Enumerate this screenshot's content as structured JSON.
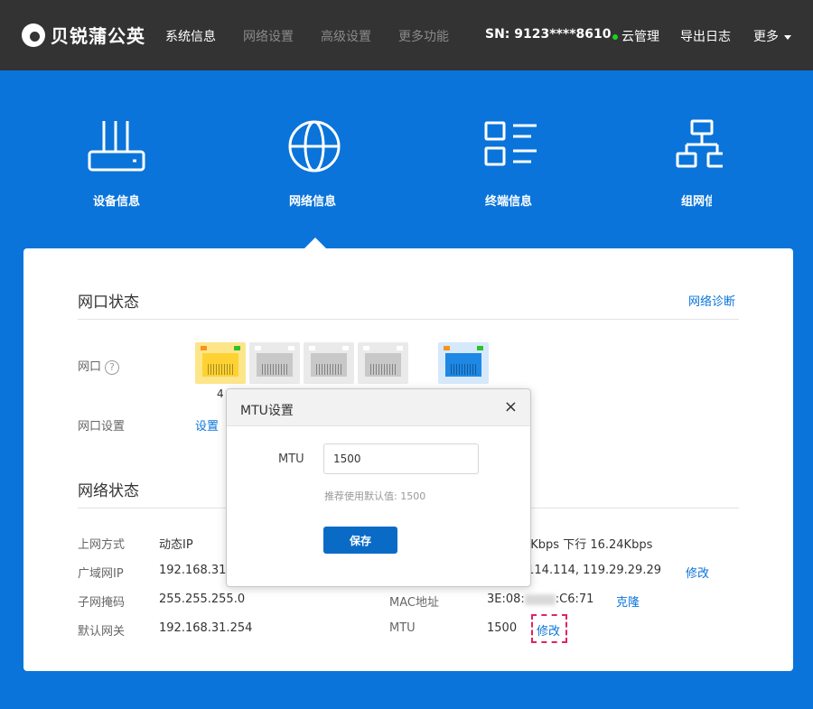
{
  "brand": {
    "name": "贝锐蒲公英"
  },
  "nav": {
    "items": [
      "系统信息",
      "网络设置",
      "高级设置",
      "更多功能"
    ]
  },
  "header": {
    "sn": "SN: 9123****8610",
    "cloud": "云管理",
    "export_log": "导出日志",
    "more": "更多"
  },
  "categories": [
    "设备信息",
    "网络信息",
    "终端信息",
    "组网信"
  ],
  "ports": {
    "title": "网口状态",
    "diag_link": "网络诊断",
    "port_label": "网口",
    "help": "?",
    "port_number": "4",
    "setting_label": "网口设置",
    "setting_link": "设置"
  },
  "network": {
    "title": "网络状态",
    "rows_left": [
      {
        "label": "上网方式",
        "value": "动态IP"
      },
      {
        "label": "广域网IP",
        "value": "192.168.31."
      },
      {
        "label": "子网掩码",
        "value": "255.255.255.0"
      },
      {
        "label": "默认网关",
        "value": "192.168.31.254"
      }
    ],
    "speed": "5Kbps  下行 16.24Kbps",
    "dns": ".114.114,  119.29.29.29",
    "dns_edit": "修改",
    "mac_label": "MAC地址",
    "mac_prefix": "3E:08:",
    "mac_suffix": ":C6:71",
    "mac_clone": "克隆",
    "mtu_label": "MTU",
    "mtu_value": "1500",
    "mtu_edit": "修改"
  },
  "modal": {
    "title": "MTU设置",
    "close": "×",
    "field_label": "MTU",
    "field_value": "1500",
    "hint": "推荐使用默认值: 1500",
    "save": "保存"
  },
  "colors": {
    "accent": "#0a74da",
    "topbar": "#333333",
    "port_active": "#ffd84a",
    "port_wan": "#1e88e5"
  }
}
